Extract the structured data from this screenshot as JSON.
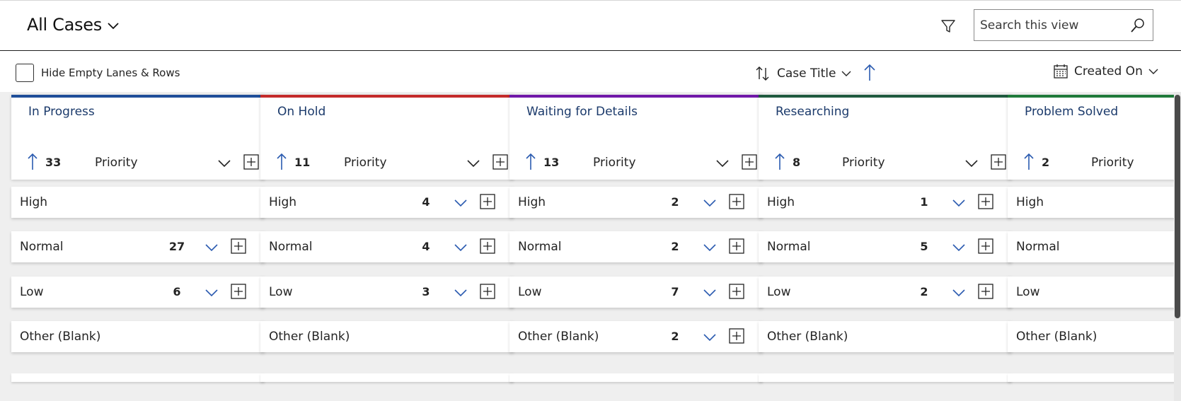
{
  "header": {
    "view_title": "All Cases",
    "search_placeholder": "Search this view"
  },
  "toolbar": {
    "hide_empty_label": "Hide Empty Lanes & Rows",
    "sort_field": "Case Title",
    "date_field": "Created On"
  },
  "colors": {
    "in_progress": "#1f4e99",
    "on_hold": "#c42b2b",
    "waiting": "#7018a8",
    "researching": "#1f5a3f",
    "problem_solved": "#1f7a3a",
    "lane_title": "#1b3a6b",
    "icon_blue": "#2b5bb0"
  },
  "lanes": [
    {
      "title": "In Progress",
      "count": "33",
      "field": "Priority",
      "rows": [
        {
          "label": "High",
          "count": ""
        },
        {
          "label": "Normal",
          "count": "27"
        },
        {
          "label": "Low",
          "count": "6"
        },
        {
          "label": "Other (Blank)",
          "count": ""
        }
      ]
    },
    {
      "title": "On Hold",
      "count": "11",
      "field": "Priority",
      "rows": [
        {
          "label": "High",
          "count": "4"
        },
        {
          "label": "Normal",
          "count": "4"
        },
        {
          "label": "Low",
          "count": "3"
        },
        {
          "label": "Other (Blank)",
          "count": ""
        }
      ]
    },
    {
      "title": "Waiting for Details",
      "count": "13",
      "field": "Priority",
      "rows": [
        {
          "label": "High",
          "count": "2"
        },
        {
          "label": "Normal",
          "count": "2"
        },
        {
          "label": "Low",
          "count": "7"
        },
        {
          "label": "Other (Blank)",
          "count": "2"
        }
      ]
    },
    {
      "title": "Researching",
      "count": "8",
      "field": "Priority",
      "rows": [
        {
          "label": "High",
          "count": "1"
        },
        {
          "label": "Normal",
          "count": "5"
        },
        {
          "label": "Low",
          "count": "2"
        },
        {
          "label": "Other (Blank)",
          "count": ""
        }
      ]
    },
    {
      "title": "Problem Solved",
      "count": "2",
      "field": "Priority",
      "rows": [
        {
          "label": "High",
          "count": ""
        },
        {
          "label": "Normal",
          "count": ""
        },
        {
          "label": "Low",
          "count": ""
        },
        {
          "label": "Other (Blank)",
          "count": ""
        }
      ]
    }
  ]
}
